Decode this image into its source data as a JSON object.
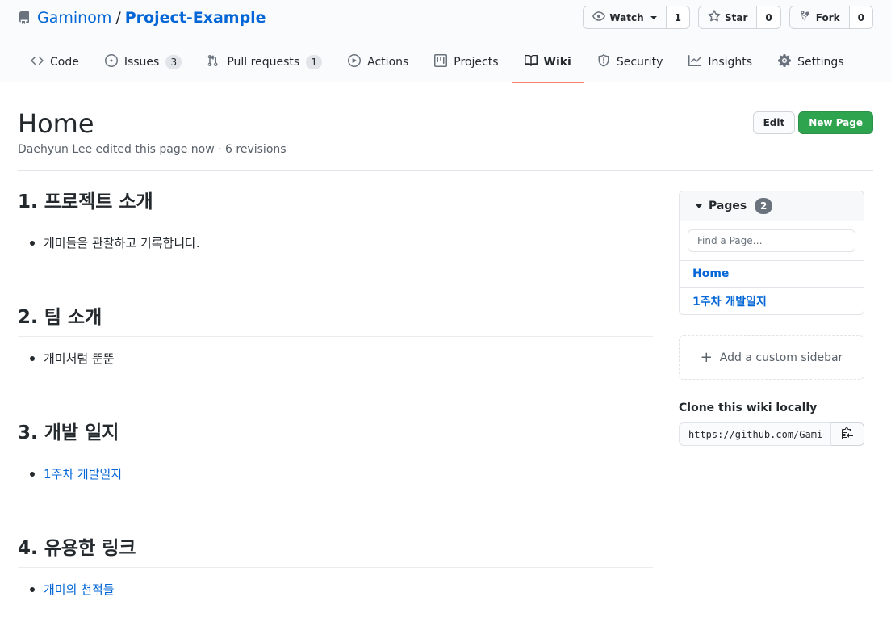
{
  "repo": {
    "owner": "Gaminom",
    "separator": "/",
    "name": "Project-Example"
  },
  "actions": {
    "watch_label": "Watch",
    "watch_count": "1",
    "star_label": "Star",
    "star_count": "0",
    "fork_label": "Fork",
    "fork_count": "0"
  },
  "tabs": [
    {
      "label": "Code",
      "icon": "code-icon"
    },
    {
      "label": "Issues",
      "icon": "issue-icon",
      "counter": "3"
    },
    {
      "label": "Pull requests",
      "icon": "pull-request-icon",
      "counter": "1"
    },
    {
      "label": "Actions",
      "icon": "play-icon"
    },
    {
      "label": "Projects",
      "icon": "project-icon"
    },
    {
      "label": "Wiki",
      "icon": "book-icon",
      "selected": true
    },
    {
      "label": "Security",
      "icon": "shield-icon"
    },
    {
      "label": "Insights",
      "icon": "graph-icon"
    },
    {
      "label": "Settings",
      "icon": "gear-icon"
    }
  ],
  "page": {
    "title": "Home",
    "meta": "Daehyun Lee edited this page now · 6 revisions",
    "edit_label": "Edit",
    "new_page_label": "New Page"
  },
  "content": [
    {
      "heading": "1. 프로젝트 소개",
      "items": [
        {
          "text": "개미들을 관찰하고 기록합니다.",
          "link": false
        }
      ]
    },
    {
      "heading": "2. 팀 소개",
      "items": [
        {
          "text": "개미처럼 뚠뚠",
          "link": false
        }
      ]
    },
    {
      "heading": "3. 개발 일지",
      "items": [
        {
          "text": "1주차 개발일지",
          "link": true
        }
      ]
    },
    {
      "heading": "4. 유용한 링크",
      "items": [
        {
          "text": "개미의 천적들",
          "link": true
        }
      ]
    }
  ],
  "sidebar": {
    "pages_label": "Pages",
    "pages_count": "2",
    "filter_placeholder": "Find a Page…",
    "pages": [
      "Home",
      "1주차 개발일지"
    ],
    "add_sidebar_label": "Add a custom sidebar",
    "clone_title": "Clone this wiki locally",
    "clone_url": "https://github.com/Gaminom/Project-Example.wiki.git"
  },
  "colors": {
    "link": "#0366d6",
    "primary_button": "#2ea44f",
    "selected_tab_underline": "#f9826c"
  }
}
